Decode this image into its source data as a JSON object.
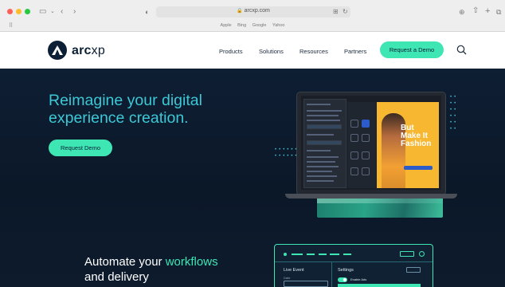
{
  "browser": {
    "url": "arcxp.com",
    "favorites": [
      "Apple",
      "Bing",
      "Google",
      "Yahoo"
    ]
  },
  "nav": {
    "logo_prefix": "arc",
    "logo_suffix": "xp",
    "links": [
      "Products",
      "Solutions",
      "Resources",
      "Partners"
    ],
    "cta_label": "Request a Demo"
  },
  "hero": {
    "title": "Reimagine your digital experience creation.",
    "cta_label": "Request Demo",
    "promo_text_line1": "But",
    "promo_text_line2": "Make It",
    "promo_text_line3": "Fashion"
  },
  "section2": {
    "title_plain_1": "Automate your ",
    "title_accent": "workflows",
    "title_plain_2": "and delivery"
  },
  "ui_card": {
    "left_label": "Live Event",
    "left_sub": "Date",
    "right_label": "Settings",
    "toggle_label": "Enable Ads"
  },
  "colors": {
    "accent": "#3ee6b4",
    "headline": "#3cc8d6",
    "hero_bg": "#0c1a2c"
  }
}
